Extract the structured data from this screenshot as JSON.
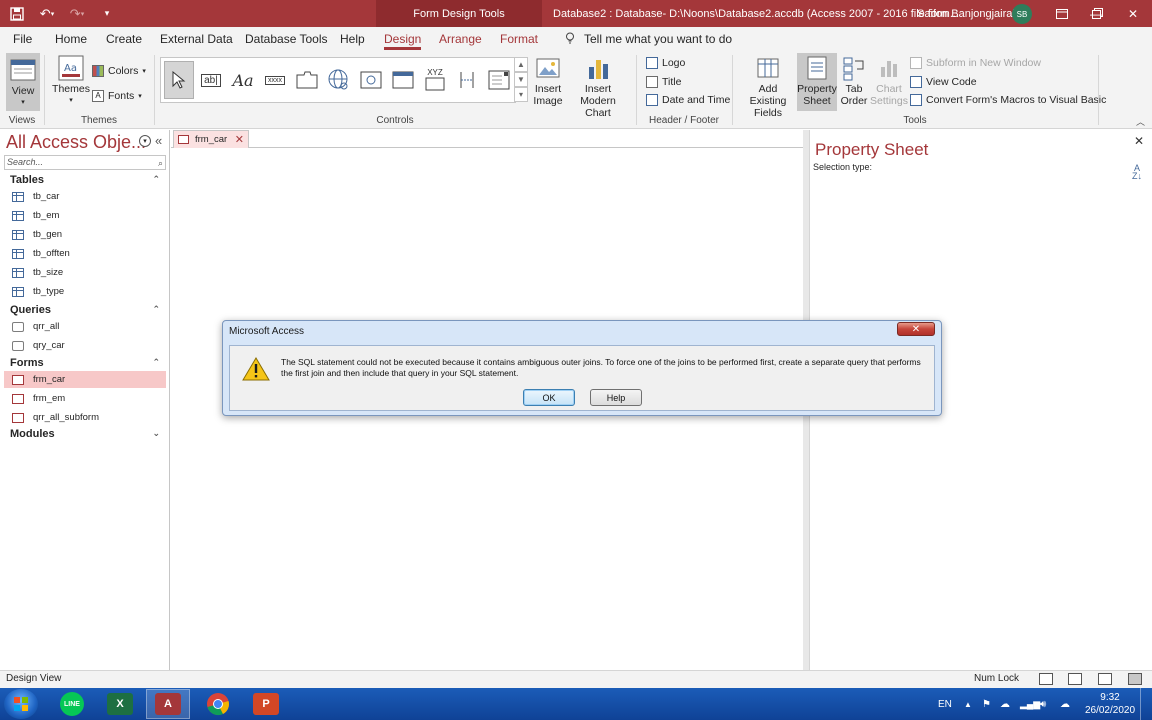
{
  "titlebar": {
    "context_tab": "Form Design Tools",
    "document_title": "Database2 : Database- D:\\Noons\\Database2.accdb (Access 2007 - 2016 file form...",
    "user_name": "Saifon Banjongjairak",
    "avatar_initials": "SB",
    "qat": [
      "save-icon",
      "undo-icon",
      "redo-icon",
      "customize-icon"
    ]
  },
  "menu_tabs": [
    "File",
    "Home",
    "Create",
    "External Data",
    "Database Tools",
    "Help",
    "Design",
    "Arrange",
    "Format"
  ],
  "active_tab": "Design",
  "tell_me": "Tell me what you want to do",
  "ribbon": {
    "views": {
      "view_label": "View",
      "group_label": "Views"
    },
    "themes": {
      "themes_label": "Themes",
      "colors_label": "Colors",
      "fonts_label": "Fonts",
      "group_label": "Themes"
    },
    "controls": {
      "group_label": "Controls",
      "insert_image": "Insert Image",
      "insert_modern_chart": "Insert Modern Chart",
      "xyz_label": "XYZ",
      "text_box": "ab|",
      "label_sample": "Aa",
      "xxxx_label": "xxxx"
    },
    "header_footer": {
      "logo": "Logo",
      "title": "Title",
      "date_time": "Date and Time",
      "group_label": "Header / Footer"
    },
    "tools": {
      "add_existing_fields": "Add Existing Fields",
      "property_sheet": "Property Sheet",
      "tab_order": "Tab Order",
      "chart_settings": "Chart Settings",
      "subform_new_window": "Subform in New Window",
      "view_code": "View Code",
      "convert_macros": "Convert Form's Macros to Visual Basic",
      "group_label": "Tools"
    }
  },
  "nav_pane": {
    "title": "All Access Obje...",
    "search_placeholder": "Search...",
    "categories": {
      "tables": "Tables",
      "queries": "Queries",
      "forms": "Forms",
      "modules": "Modules"
    },
    "tables": [
      "tb_car",
      "tb_em",
      "tb_gen",
      "tb_offten",
      "tb_size",
      "tb_type"
    ],
    "queries": [
      "qrr_all",
      "qry_car"
    ],
    "forms": [
      "frm_car",
      "frm_em",
      "qrr_all_subform"
    ],
    "selected_item": "frm_car"
  },
  "document_tab": "frm_car",
  "property_sheet": {
    "title": "Property Sheet",
    "selection_type_label": "Selection type:"
  },
  "dialog": {
    "title": "Microsoft Access",
    "message": "The SQL statement could not be executed because it contains ambiguous outer joins. To force one of the joins to be performed first, create a separate query that performs the first join and then include that query in your SQL statement.",
    "ok_label": "OK",
    "help_label": "Help"
  },
  "statusbar": {
    "mode": "Design View",
    "num_lock": "Num Lock"
  },
  "taskbar": {
    "apps": [
      "line-app-icon",
      "excel-app-icon",
      "access-app-icon",
      "chrome-app-icon",
      "powerpoint-app-icon"
    ],
    "running_app": "access-app-icon",
    "language": "EN",
    "time": "9:32",
    "date": "26/02/2020"
  },
  "colors": {
    "accent": "#a4373a",
    "taskbar": "#1b5cb8",
    "dialog_frame": "#d7e6f8"
  }
}
